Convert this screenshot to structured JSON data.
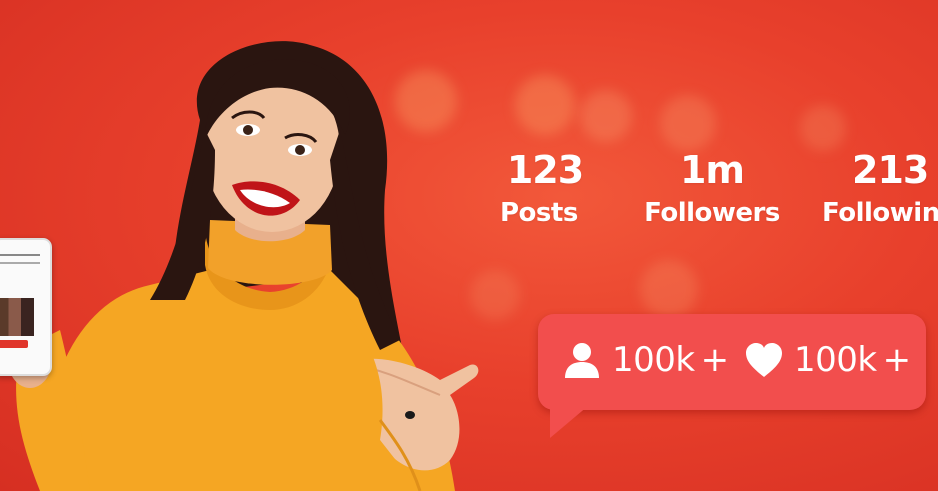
{
  "colors": {
    "background": "#e8402c",
    "badge": "#f24e4d",
    "text": "#ffffff",
    "sweater": "#f5a623"
  },
  "stats": [
    {
      "value": "123",
      "label": "Posts"
    },
    {
      "value": "1m",
      "label": "Followers"
    },
    {
      "value": "213",
      "label": "Followin"
    }
  ],
  "badge": {
    "followers_icon": "user-icon",
    "followers_value": "100k",
    "followers_plus": "+",
    "likes_icon": "heart-icon",
    "likes_value": "100k",
    "likes_plus": "+"
  }
}
